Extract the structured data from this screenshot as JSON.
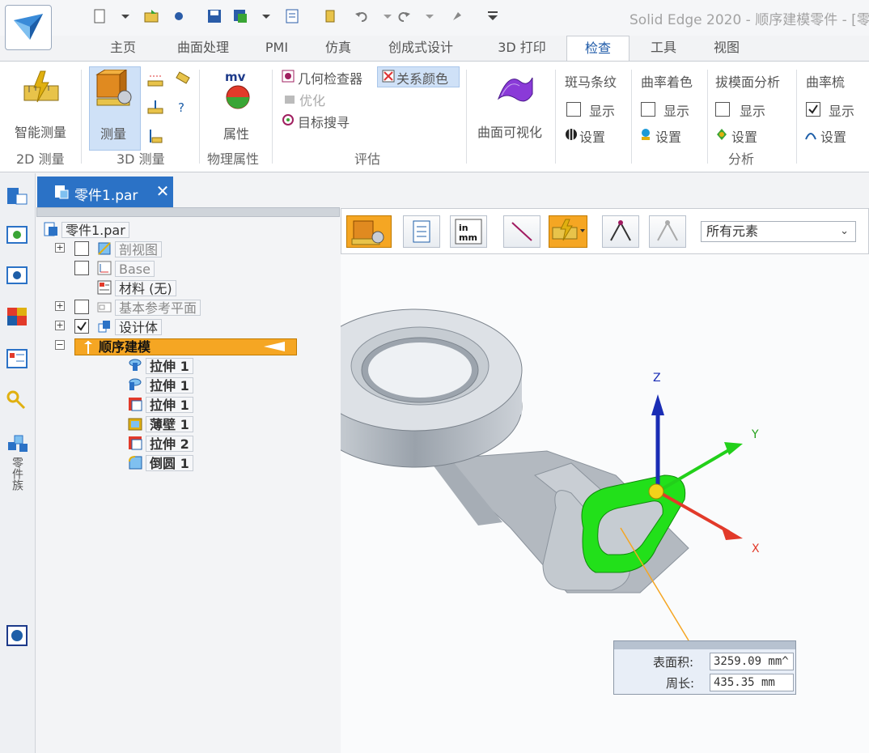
{
  "window": {
    "title": "Solid Edge 2020 - 顺序建模零件 - [零"
  },
  "tabs": [
    "主页",
    "曲面处理",
    "PMI",
    "仿真",
    "创成式设计",
    "3D 打印",
    "检查",
    "工具",
    "视图"
  ],
  "active_tab": "检查",
  "ribbon": {
    "smart_measure": "智能测量",
    "measure": "测量",
    "properties": "属性",
    "geometry_inspector": "几何检查器",
    "optimize": "优化",
    "relationship_colors": "关系颜色",
    "target_search": "目标搜寻",
    "surface_visualization": "曲面可视化",
    "zebra": "斑马条纹",
    "curvature_shading": "曲率着色",
    "draft_analysis": "拔模面分析",
    "curvature_comb": "曲率梳",
    "show": "显示",
    "settings": "设置",
    "groups": {
      "measure_2d": "2D 测量",
      "measure_3d": "3D 测量",
      "physical_properties": "物理属性",
      "evaluate": "评估",
      "analysis": "分析"
    }
  },
  "document_tab": {
    "label": "零件1.par"
  },
  "tree": {
    "root": "零件1.par",
    "section_view": "剖视图",
    "base": "Base",
    "material": "材料 (无)",
    "ref_planes": "基本参考平面",
    "design_body": "设计体",
    "ordered": "顺序建模",
    "features": [
      "拉伸 1",
      "拉伸 1",
      "拉伸 1",
      "薄壁 1",
      "拉伸 2",
      "倒圆 1"
    ]
  },
  "sidebar": {
    "part_family": "零件族"
  },
  "command_bar": {
    "filter": "所有元素"
  },
  "axes": {
    "x": "X",
    "y": "Y",
    "z": "Z"
  },
  "measurement": {
    "area_label": "表面积:",
    "area_value": "3259.09 mm^",
    "perimeter_label": "周长:",
    "perimeter_value": "435.35 mm"
  },
  "colors": {
    "accent": "#2b72c6",
    "highlight": "#f5a623",
    "selected_face": "#22e01a"
  }
}
